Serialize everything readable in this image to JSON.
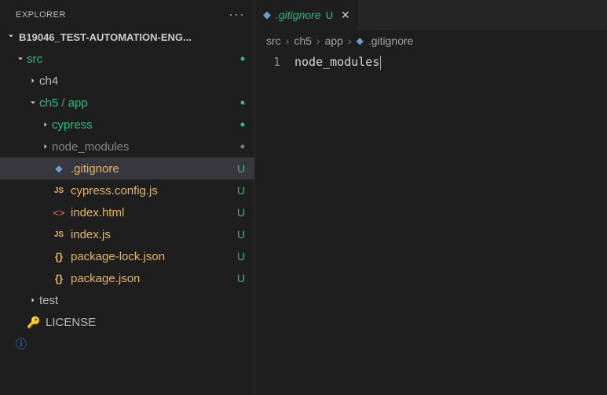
{
  "sidebar": {
    "title": "EXPLORER",
    "project": "B19046_TEST-AUTOMATION-ENG..."
  },
  "tree": {
    "src": {
      "label": "src"
    },
    "ch4": {
      "label": "ch4"
    },
    "ch5": {
      "label": "ch5",
      "sub": "app"
    },
    "cypress": {
      "label": "cypress"
    },
    "node_modules": {
      "label": "node_modules"
    },
    "gitignore": {
      "label": ".gitignore",
      "status": "U"
    },
    "cypress_config": {
      "label": "cypress.config.js",
      "status": "U"
    },
    "index_html": {
      "label": "index.html",
      "status": "U"
    },
    "index_js": {
      "label": "index.js",
      "status": "U"
    },
    "pkg_lock": {
      "label": "package-lock.json",
      "status": "U"
    },
    "pkg": {
      "label": "package.json",
      "status": "U"
    },
    "test": {
      "label": "test"
    },
    "license": {
      "label": "LICENSE"
    }
  },
  "tab": {
    "name": ".gitignore",
    "badge": "U"
  },
  "breadcrumbs": {
    "p1": "src",
    "p2": "ch5",
    "p3": "app",
    "p4": ".gitignore"
  },
  "editor": {
    "line1_num": "1",
    "line1": "node_modules"
  }
}
